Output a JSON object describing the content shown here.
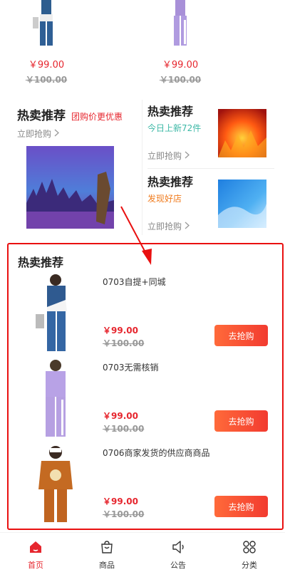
{
  "top_products": [
    {
      "price": "￥99.00",
      "original_price": "￥100.00"
    },
    {
      "price": "￥99.00",
      "original_price": "￥100.00"
    }
  ],
  "promo": {
    "big": {
      "title": "热卖推荐",
      "badge": "团购价更优惠",
      "link": "立即抢购"
    },
    "small": [
      {
        "title": "热卖推荐",
        "subtitle": "今日上新72件",
        "subtitle_color": "#3cb8a6",
        "link": "立即抢购"
      },
      {
        "title": "热卖推荐",
        "subtitle": "发现好店",
        "subtitle_color": "#f07b1d",
        "link": "立即抢购"
      }
    ]
  },
  "hot_section": {
    "title": "热卖推荐",
    "items": [
      {
        "name": "0703自提+同城",
        "price": "￥99.00",
        "original_price": "￥100.00",
        "button": "去抢购"
      },
      {
        "name": "0703无需核销",
        "price": "￥99.00",
        "original_price": "￥100.00",
        "button": "去抢购"
      },
      {
        "name": "0706商家发货的供应商商品",
        "price": "￥99.00",
        "original_price": "￥100.00",
        "button": "去抢购"
      }
    ]
  },
  "tabbar": {
    "items": [
      {
        "label": "首页",
        "icon": "home-icon",
        "active": true
      },
      {
        "label": "商品",
        "icon": "shopping-bag-icon",
        "active": false
      },
      {
        "label": "公告",
        "icon": "megaphone-icon",
        "active": false
      },
      {
        "label": "分类",
        "icon": "grid-icon",
        "active": false
      }
    ]
  },
  "colors": {
    "accent": "#e6262e",
    "highlight_border": "#e91010"
  }
}
